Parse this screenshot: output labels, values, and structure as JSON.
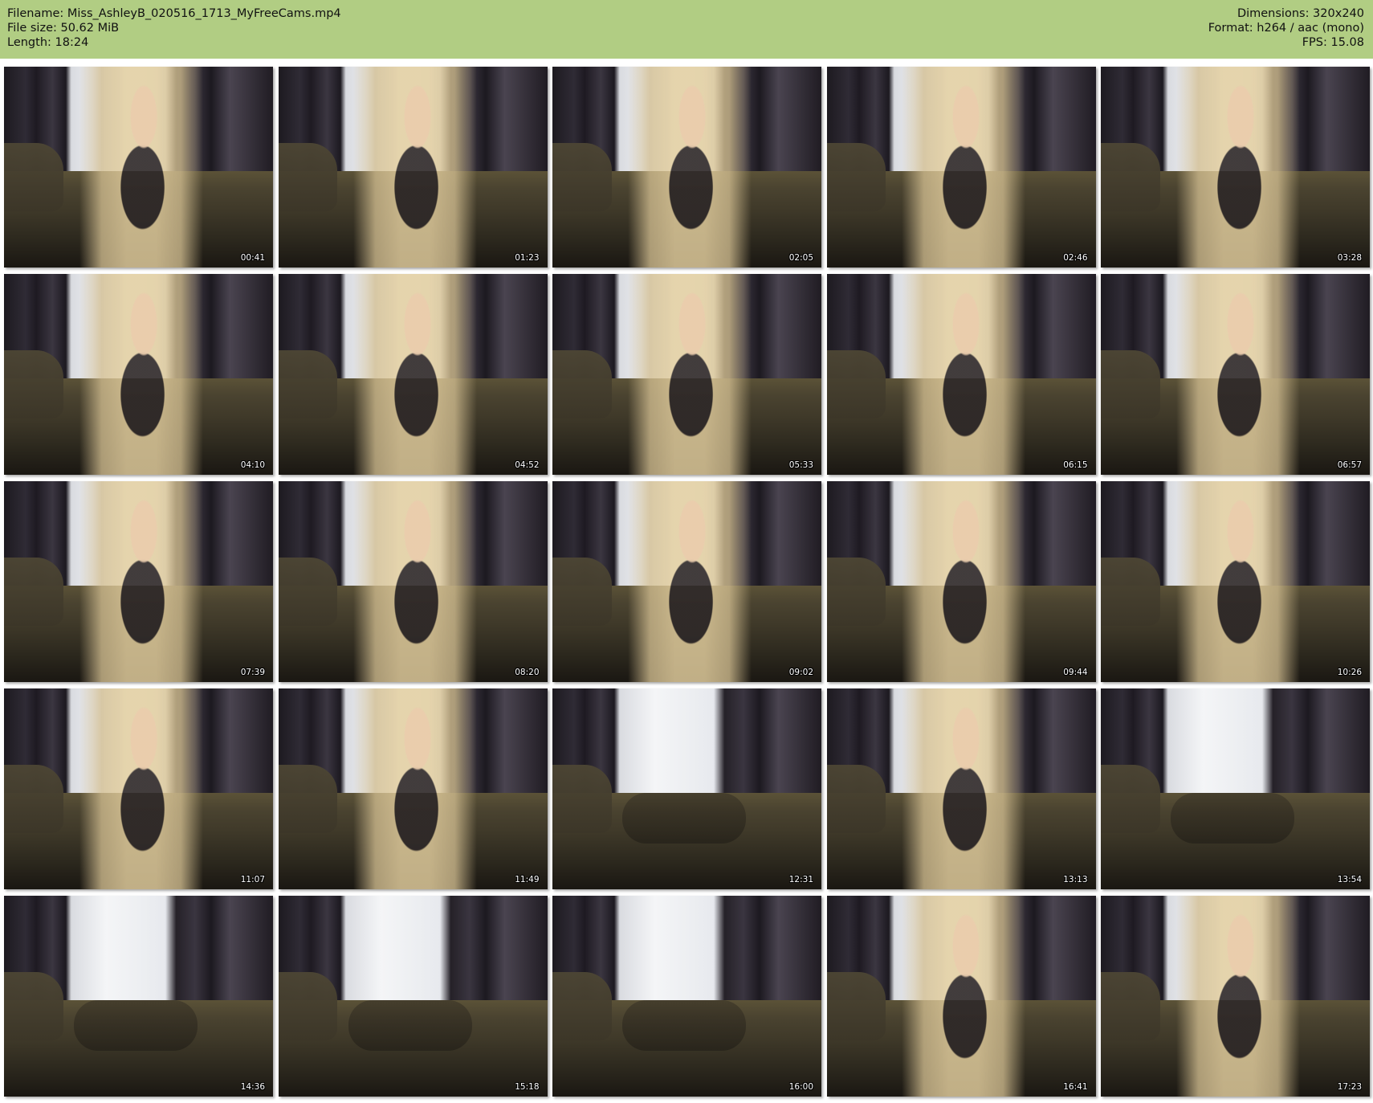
{
  "file_info": {
    "filename_line": "Filename: Miss_AshleyB_020516_1713_MyFreeCams.mp4",
    "filesize_line": "File size: 50.62 MiB",
    "length_line": "Length: 18:24",
    "dimensions_line": "Dimensions: 320x240",
    "format_line": "Format: h264 / aac (mono)",
    "fps_line": "FPS: 15.08"
  },
  "colors": {
    "header_background": "#b1cd83",
    "page_background": "#ffffff"
  },
  "thumbnails": [
    {
      "time": "00:41",
      "subject": "present"
    },
    {
      "time": "01:23",
      "subject": "present"
    },
    {
      "time": "02:05",
      "subject": "present"
    },
    {
      "time": "02:46",
      "subject": "present"
    },
    {
      "time": "03:28",
      "subject": "present"
    },
    {
      "time": "04:10",
      "subject": "present"
    },
    {
      "time": "04:52",
      "subject": "present"
    },
    {
      "time": "05:33",
      "subject": "present"
    },
    {
      "time": "06:15",
      "subject": "present"
    },
    {
      "time": "06:57",
      "subject": "present"
    },
    {
      "time": "07:39",
      "subject": "present"
    },
    {
      "time": "08:20",
      "subject": "present"
    },
    {
      "time": "09:02",
      "subject": "present"
    },
    {
      "time": "09:44",
      "subject": "present"
    },
    {
      "time": "10:26",
      "subject": "present"
    },
    {
      "time": "11:07",
      "subject": "present"
    },
    {
      "time": "11:49",
      "subject": "present"
    },
    {
      "time": "12:31",
      "subject": "absent"
    },
    {
      "time": "13:13",
      "subject": "present"
    },
    {
      "time": "13:54",
      "subject": "absent"
    },
    {
      "time": "14:36",
      "subject": "absent"
    },
    {
      "time": "15:18",
      "subject": "absent"
    },
    {
      "time": "16:00",
      "subject": "absent"
    },
    {
      "time": "16:41",
      "subject": "present"
    },
    {
      "time": "17:23",
      "subject": "present"
    }
  ]
}
